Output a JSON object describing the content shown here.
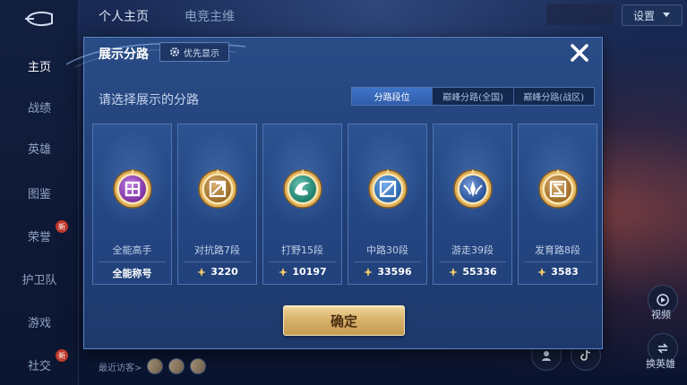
{
  "background": {
    "left_nav": {
      "items": [
        {
          "label": "主页",
          "active": true
        },
        {
          "label": "战绩",
          "active": false
        },
        {
          "label": "英雄",
          "active": false
        },
        {
          "label": "图鉴",
          "active": false
        },
        {
          "label": "荣誉",
          "active": false,
          "badge": "新"
        },
        {
          "label": "护卫队",
          "active": false
        },
        {
          "label": "游戏",
          "active": false
        },
        {
          "label": "社交",
          "active": false,
          "badge": "新"
        }
      ]
    },
    "top_tabs": [
      {
        "label": "个人主页",
        "active": true
      },
      {
        "label": "电竞主维",
        "active": false
      }
    ],
    "settings_label": "设置",
    "recent_visitors_label": "最近访客>",
    "right_labels": {
      "top": "视频",
      "bottom": "换英雄"
    }
  },
  "modal": {
    "title": "展示分路",
    "priority_button": "优先显示",
    "subtitle": "请选择展示的分路",
    "segments": [
      {
        "label": "分路段位",
        "active": true
      },
      {
        "label": "巅峰分路(全国)",
        "active": false
      },
      {
        "label": "巅峰分路(战区)",
        "active": false
      }
    ],
    "cards": [
      {
        "id": "all",
        "label": "全能高手",
        "value": "全能称号",
        "badge_color": "#a23bd6",
        "show_power_icon": false
      },
      {
        "id": "clash",
        "label": "对抗路7段",
        "value": "3220",
        "badge_color": "#c9892c",
        "show_power_icon": true
      },
      {
        "id": "jungle",
        "label": "打野15段",
        "value": "10197",
        "badge_color": "#1ea78c",
        "show_power_icon": true
      },
      {
        "id": "mid",
        "label": "中路30段",
        "value": "33596",
        "badge_color": "#2f82e0",
        "show_power_icon": true
      },
      {
        "id": "roam",
        "label": "游走39段",
        "value": "55336",
        "badge_color": "#2f68c9",
        "show_power_icon": true
      },
      {
        "id": "farm",
        "label": "发育路8段",
        "value": "3583",
        "badge_color": "#cf8a2b",
        "show_power_icon": true
      }
    ],
    "confirm_button": "确定"
  }
}
